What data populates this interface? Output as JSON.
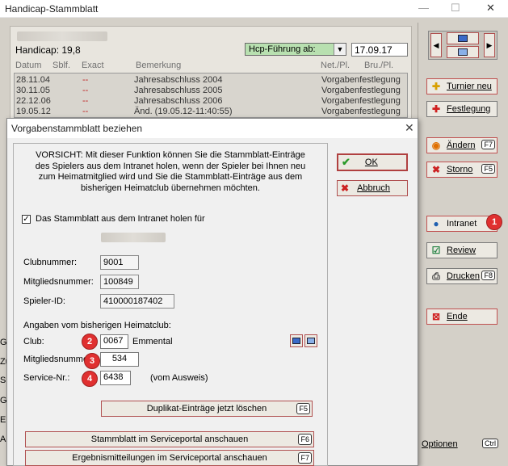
{
  "parent": {
    "title": "Handicap-Stammblatt",
    "handicap_label": "Handicap: 19,8",
    "hcp_select": "Hcp-Führung ab:",
    "date": "17.09.17",
    "columns": [
      "Datum",
      "Sblf.",
      "Exact",
      "Bemerkung",
      "Net./Pl.",
      "Bru./Pl."
    ],
    "rows": [
      {
        "date": "28.11.04",
        "mark": "--",
        "note": "Jahresabschluss 2004",
        "type": "Vorgabenfestlegung"
      },
      {
        "date": "30.11.05",
        "mark": "--",
        "note": "Jahresabschluss 2005",
        "type": "Vorgabenfestlegung"
      },
      {
        "date": "22.12.06",
        "mark": "--",
        "note": "Jahresabschluss 2006",
        "type": "Vorgabenfestlegung"
      },
      {
        "date": "19.05.12",
        "mark": "--",
        "note": "Änd. (19.05.12-11:40:55)",
        "type": "Vorgabenfestlegung"
      }
    ],
    "left_edge_letters": [
      "Gr",
      "Zu",
      "Sp",
      "Gr",
      "Ei",
      "Au"
    ]
  },
  "toolbar": {
    "turnier_neu": "Turnier neu",
    "festlegung": "Festlegung",
    "aendern": "Ändern",
    "aendern_key": "F7",
    "storno": "Storno",
    "storno_key": "F5",
    "intranet": "Intranet",
    "review": "Review",
    "drucken": "Drucken",
    "drucken_key": "F8",
    "ende": "Ende",
    "optionen": "Optionen",
    "optionen_key": "Ctrl"
  },
  "dialog": {
    "title": "Vorgabenstammblatt beziehen",
    "warning": "VORSICHT: Mit dieser Funktion können Sie die Stammblatt-Einträge des Spielers aus dem Intranet holen, wenn der Spieler bei Ihnen neu zum Heimatmitglied wird und Sie die Stammblatt-Einträge aus dem bisherigen Heimatclub übernehmen möchten.",
    "checkbox_label": "Das Stammblatt aus dem Intranet holen für",
    "clubnummer_label": "Clubnummer:",
    "clubnummer": "9001",
    "mitgliedsnummer_label": "Mitgliedsnummer:",
    "mitgliedsnummer": "100849",
    "spieler_id_label": "Spieler-ID:",
    "spieler_id": "410000187402",
    "section_label": "Angaben vom bisherigen Heimatclub:",
    "club_label": "Club:",
    "club_value": "0067",
    "club_name": "Emmental",
    "mitgliedsnummer2_label": "Mitgliedsnummer:",
    "mitgliedsnummer2": "534",
    "service_label": "Service-Nr.:",
    "service_value": "6438",
    "service_note": "(vom Ausweis)",
    "duplikat_btn": "Duplikat-Einträge jetzt löschen",
    "duplikat_key": "F5",
    "stammblatt_btn": "Stammblatt im Serviceportal anschauen",
    "stammblatt_key": "F6",
    "ergebnis_btn": "Ergebnismitteilungen im Serviceportal anschauen",
    "ergebnis_key": "F7",
    "ok": "OK",
    "abbruch": "Abbruch"
  },
  "annotations": {
    "b1": "1",
    "b2": "2",
    "b3": "3",
    "b4": "4"
  },
  "colors": {
    "accent_red": "#e03030",
    "ok_green": "#2a9a2a",
    "cancel_red": "#cc2222"
  }
}
